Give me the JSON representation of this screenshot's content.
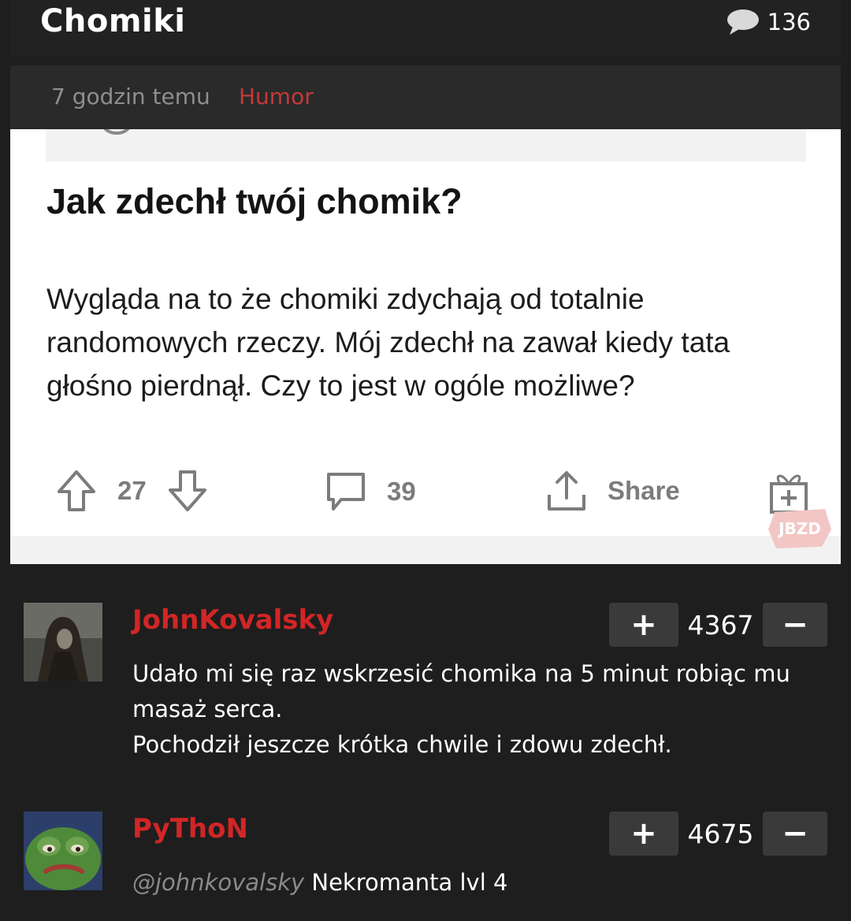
{
  "header": {
    "title": "Chomiki",
    "comment_count": "136"
  },
  "meta": {
    "time_ago": "7 godzin temu",
    "category": "Humor"
  },
  "embed": {
    "title": "Jak zdechł twój chomik?",
    "body": "Wygląda na to że chomiki zdychają od totalnie randomowych rzeczy. Mój zdechł na zawał kiedy tata głośno pierdnął. Czy to jest w ogóle możliwe?",
    "score": "27",
    "comments": "39",
    "share_label": "Share",
    "watermark": "JBZD"
  },
  "comments": [
    {
      "username": "JohnKovalsky",
      "score": "4367",
      "plus_label": "+",
      "minus_label": "−",
      "lines": [
        "Udało mi się raz wskrzesić chomika na 5 minut robiąc mu masaż serca.",
        "Pochodził jeszcze krótka chwile i zdowu zdechł."
      ]
    },
    {
      "username": "PyThoN",
      "score": "4675",
      "plus_label": "+",
      "minus_label": "−",
      "mention": "@johnkovalsky",
      "text": "Nekromanta lvl 4"
    }
  ],
  "colors": {
    "accent_red": "#d12626",
    "category_red": "#c23a3a",
    "background": "#1e1e1e"
  }
}
